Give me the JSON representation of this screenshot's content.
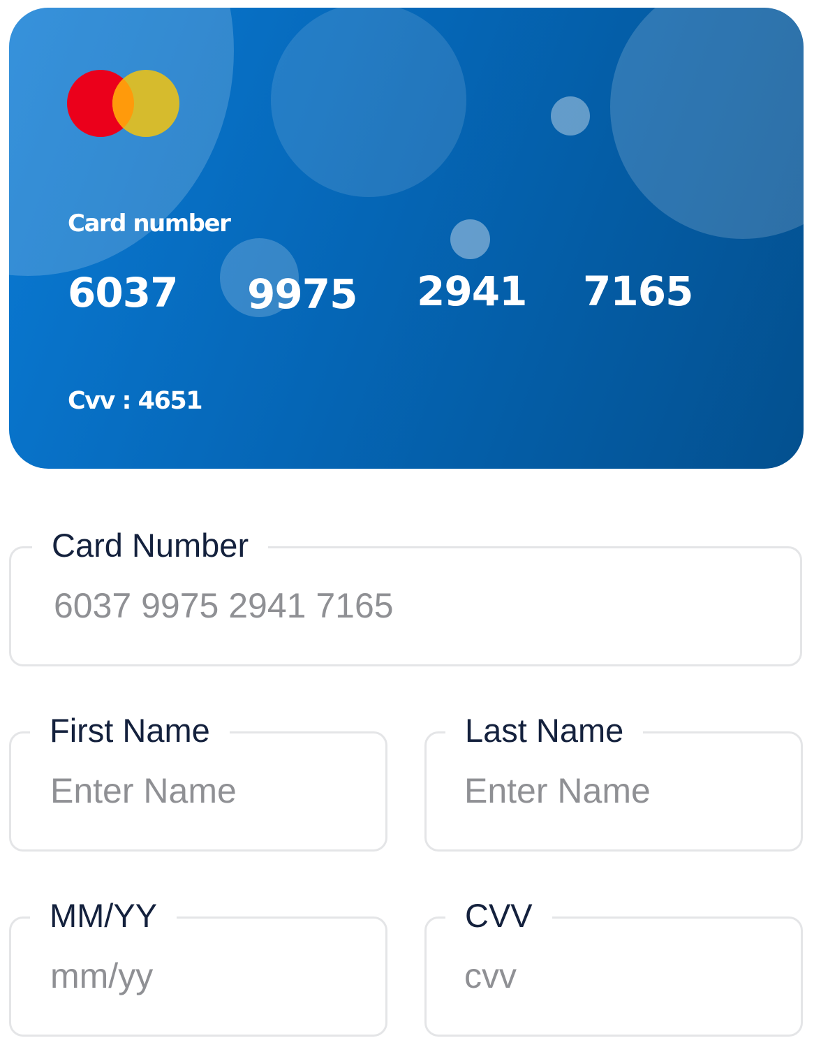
{
  "card": {
    "brand_icon": "mastercard-logo-icon",
    "number_label": "Card number",
    "number_groups": [
      "6037",
      "9975",
      "2941",
      "7165"
    ],
    "cvv_text": "Cvv : 4651",
    "colors": {
      "gradient_start": "#0a7ad4",
      "gradient_end": "#03508f",
      "logo_red": "#eb001b",
      "logo_yellow": "#d6bb2d",
      "logo_overlap": "#ff9a0b"
    }
  },
  "form": {
    "card_number": {
      "label": "Card Number",
      "placeholder": "6037 9975 2941 7165"
    },
    "first_name": {
      "label": "First Name",
      "placeholder": "Enter Name"
    },
    "last_name": {
      "label": "Last Name",
      "placeholder": "Enter Name"
    },
    "expiry": {
      "label": "MM/YY",
      "placeholder": "mm/yy"
    },
    "cvv": {
      "label": "CVV",
      "placeholder": "cvv"
    }
  }
}
